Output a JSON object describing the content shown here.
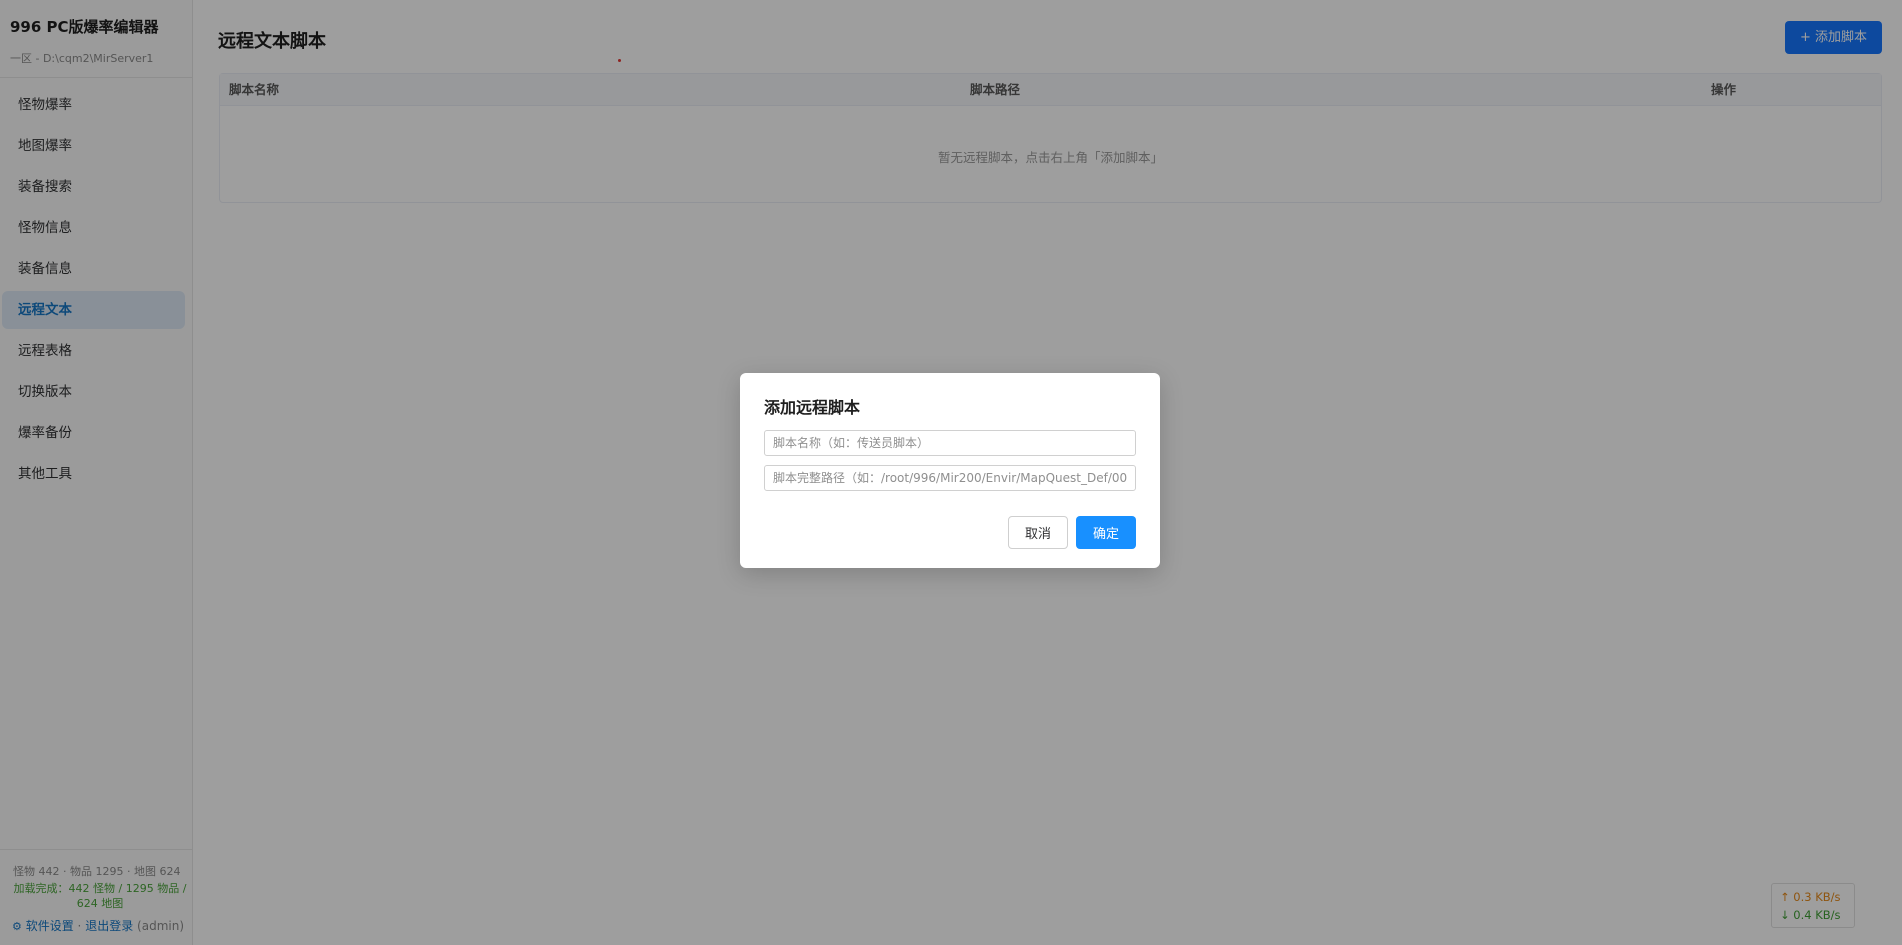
{
  "sidebar": {
    "app_title": "996 PC版爆率编辑器",
    "server_path": "一区 - D:\\cqm2\\MirServer1",
    "items": [
      {
        "label": "怪物爆率"
      },
      {
        "label": "地图爆率"
      },
      {
        "label": "装备搜索"
      },
      {
        "label": "怪物信息"
      },
      {
        "label": "装备信息"
      },
      {
        "label": "远程文本"
      },
      {
        "label": "远程表格"
      },
      {
        "label": "切换版本"
      },
      {
        "label": "爆率备份"
      },
      {
        "label": "其他工具"
      }
    ],
    "active_item": "远程文本",
    "stats": "怪物 442 · 物品 1295 · 地图 624",
    "load_status": "加载完成：442 怪物 / 1295 物品 / 624 地图",
    "settings_icon": "gear-icon",
    "settings_label": "软件设置",
    "separator": "·",
    "logout_label": "退出登录",
    "user": "(admin)"
  },
  "main": {
    "page_title": "远程文本脚本",
    "add_button_label": "+ 添加脚本",
    "table": {
      "columns": [
        "脚本名称",
        "脚本路径",
        "操作"
      ],
      "rows": [],
      "empty_text": "暂无远程脚本，点击右上角「添加脚本」"
    }
  },
  "network": {
    "upload_icon": "arrow-up-icon",
    "upload": "↑ 0.3 KB/s",
    "download_icon": "arrow-down-icon",
    "download": "↓ 0.4 KB/s"
  },
  "modal": {
    "title": "添加远程脚本",
    "name_input": {
      "value": "",
      "placeholder": "脚本名称（如：传送员脚本）"
    },
    "path_input": {
      "value": "",
      "placeholder": "脚本完整路径（如：/root/996/Mir200/Envir/MapQuest_Def/00"
    },
    "cancel_label": "取消",
    "ok_label": "确定"
  },
  "colors": {
    "accent": "#1677ff",
    "active_nav_bg": "#dde9f6",
    "success": "#4aa33a",
    "upload": "#e6891a"
  }
}
